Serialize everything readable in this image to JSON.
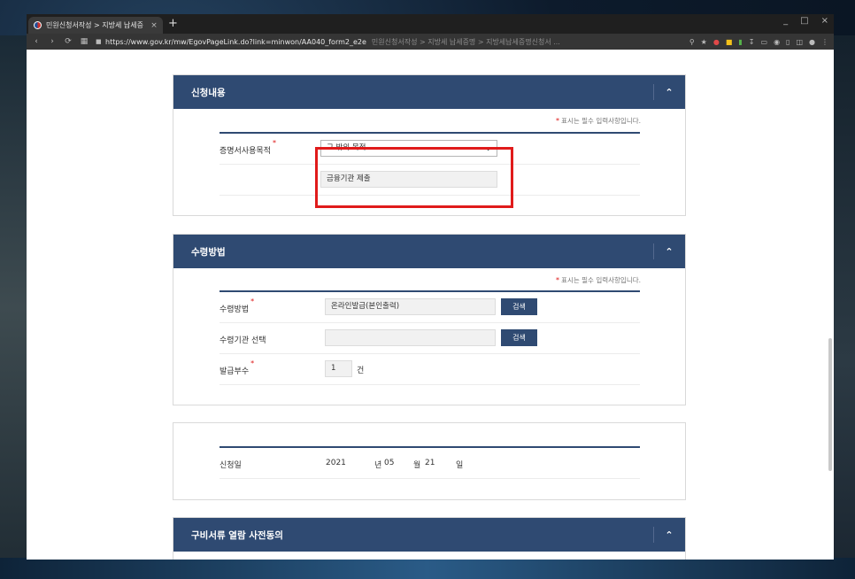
{
  "browser": {
    "tab_title": "민원신청서작성 > 지방세 납세증",
    "tab_close": "×",
    "new_tab": "+",
    "window_controls": [
      "_",
      "□",
      "×"
    ],
    "url": "https://www.gov.kr/mw/EgovPageLink.do?link=minwon/AA040_form2_e2e",
    "page_title_dim": "민원신청서작성 > 지방세 납세증명 > 지방세납세증명신청서 ..."
  },
  "required_note": "표시는 필수 입력사항입니다.",
  "section_apply": {
    "title": "신청내용",
    "purpose_label": "증명서사용목적",
    "purpose_select": "그 밖의 목적",
    "purpose_detail": "금융기관 제출"
  },
  "section_receive": {
    "title": "수령방법",
    "method_label": "수령방법",
    "method_value": "온라인발급(본인출력)",
    "method_button": "검색",
    "org_label": "수령기관 선택",
    "org_value": "",
    "org_button": "검색",
    "copies_label": "발급부수",
    "copies_value": "1",
    "copies_unit": "건"
  },
  "section_date": {
    "label": "신청일",
    "year": "2021",
    "year_unit": "년",
    "month": "05",
    "month_unit": "월",
    "day": "21",
    "day_unit": "일"
  },
  "section_consent": {
    "title": "구비서류 열람 사전동의"
  },
  "colors": {
    "header": "#2f4a72",
    "highlight": "#e01b1b",
    "required": "#dd1111"
  }
}
